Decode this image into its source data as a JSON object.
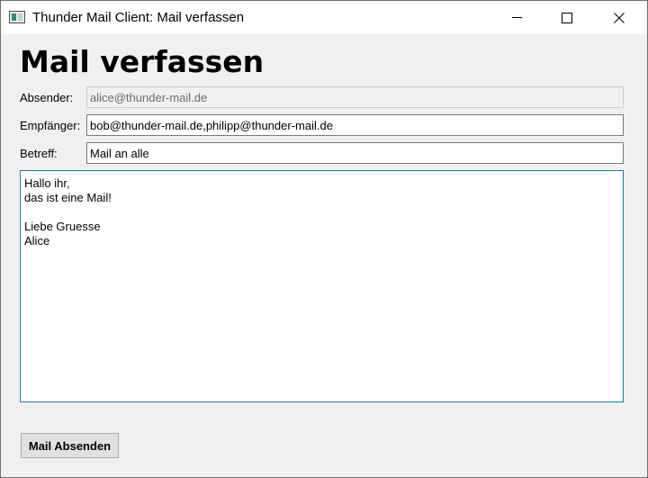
{
  "window": {
    "title": "Thunder Mail Client: Mail verfassen"
  },
  "page": {
    "heading": "Mail verfassen"
  },
  "form": {
    "sender_label": "Absender:",
    "sender_value": "alice@thunder-mail.de",
    "recipient_label": "Empfänger:",
    "recipient_value": "bob@thunder-mail.de,philipp@thunder-mail.de",
    "subject_label": "Betreff:",
    "subject_value": "Mail an alle",
    "body_value": "Hallo ihr,\ndas ist eine Mail!\n\nLiebe Gruesse\nAlice"
  },
  "actions": {
    "send_label": "Mail Absenden"
  },
  "icons": {
    "app": "app-window-icon",
    "minimize": "minimize-icon",
    "maximize": "maximize-icon",
    "close": "close-icon"
  }
}
